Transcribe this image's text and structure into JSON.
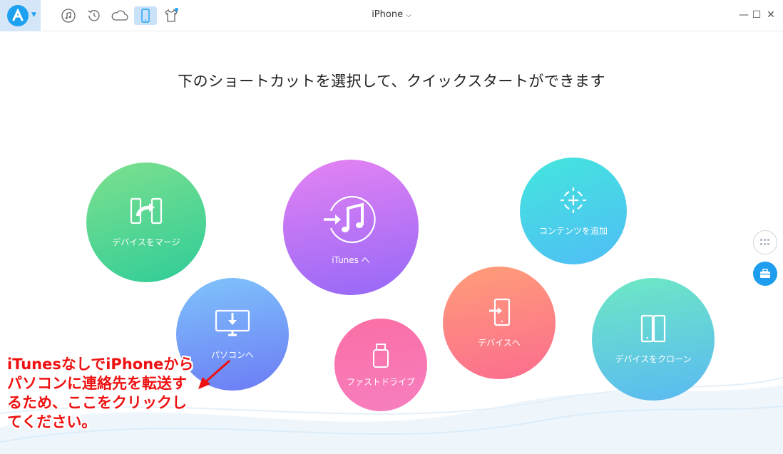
{
  "titlebar": {
    "device_name": "iPhone",
    "device_caret": "⌵",
    "window": {
      "minimize": "—",
      "maximize": "☐",
      "close": "✕"
    },
    "icons": [
      "music-icon",
      "restore-icon",
      "cloud-icon",
      "phone-icon",
      "tshirt-icon"
    ],
    "accent": "#1ea1f1"
  },
  "main": {
    "headline": "下のショートカットを選択して、クイックスタートができます",
    "shortcuts": {
      "merge": "デバイスをマージ",
      "itunes": "iTunes へ",
      "add_content": "コンテンツを追加",
      "to_pc": "パソコンへ",
      "fast_drive": "ファストドライブ",
      "to_device": "デバイスへ",
      "clone": "デバイスをクローン"
    }
  },
  "annotation": {
    "text": "iTunesなしでiPhoneからパソコンに連絡先を転送するため、ここをクリックしてください。",
    "color": "#ee1111"
  }
}
